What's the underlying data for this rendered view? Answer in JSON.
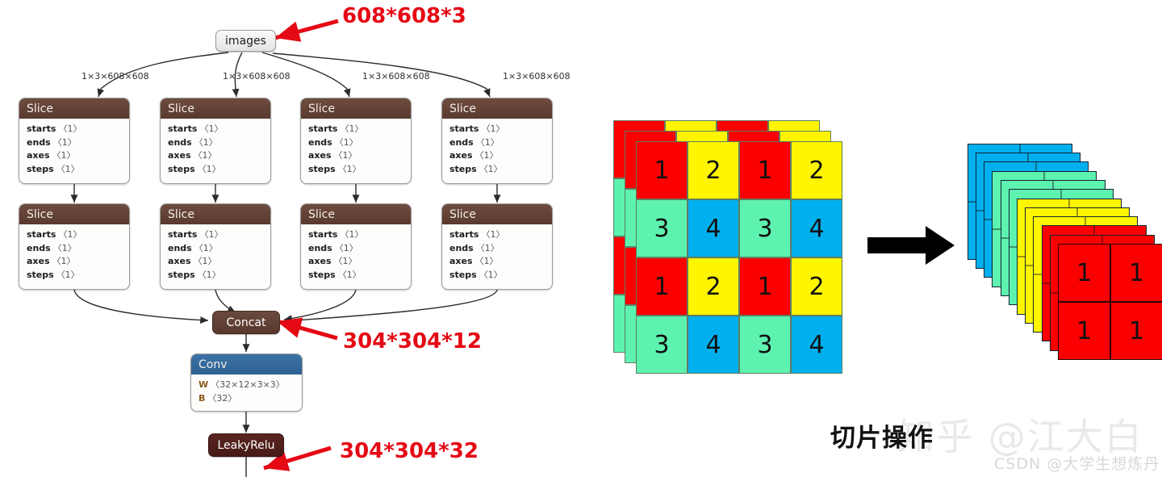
{
  "graph": {
    "input_node": {
      "label": "images"
    },
    "edge_labels": [
      "1×3×608×608",
      "1×3×608×608",
      "1×3×608×608",
      "1×3×608×608"
    ],
    "slice_title": "Slice",
    "slice_attrs": [
      {
        "name": "starts",
        "value": "〈1〉"
      },
      {
        "name": "ends",
        "value": "〈1〉"
      },
      {
        "name": "axes",
        "value": "〈1〉"
      },
      {
        "name": "steps",
        "value": "〈1〉"
      }
    ],
    "concat_node": {
      "label": "Concat"
    },
    "conv_node": {
      "label": "Conv",
      "attrs": [
        {
          "name": "W",
          "value": "〈32×12×3×3〉"
        },
        {
          "name": "B",
          "value": "〈32〉"
        }
      ]
    },
    "activation_node": {
      "label": "LeakyRelu"
    },
    "annotations": [
      {
        "text": "608*608*3",
        "color": "#e50914"
      },
      {
        "text": "304*304*12",
        "color": "#e50914"
      },
      {
        "text": "304*304*32",
        "color": "#e50914"
      }
    ]
  },
  "tensor_illustration": {
    "input_grid": {
      "rows": 4,
      "cols": 4,
      "values": [
        [
          "1",
          "2",
          "1",
          "2"
        ],
        [
          "3",
          "4",
          "3",
          "4"
        ],
        [
          "1",
          "2",
          "1",
          "2"
        ],
        [
          "3",
          "4",
          "3",
          "4"
        ]
      ],
      "colors": [
        [
          "#fa0000",
          "#fff500",
          "#fa0000",
          "#fff500"
        ],
        [
          "#5df2b0",
          "#00b0ee",
          "#5df2b0",
          "#00b0ee"
        ],
        [
          "#fa0000",
          "#fff500",
          "#fa0000",
          "#fff500"
        ],
        [
          "#5df2b0",
          "#00b0ee",
          "#5df2b0",
          "#00b0ee"
        ]
      ],
      "back_layers": 2
    },
    "output_stack": {
      "layer_count": 12,
      "layer_colors": [
        "#00b0ee",
        "#00b0ee",
        "#00b0ee",
        "#5df2b0",
        "#5df2b0",
        "#5df2b0",
        "#fff500",
        "#fff500",
        "#fff500",
        "#fa0000",
        "#fa0000",
        "#fa0000"
      ],
      "front_grid": {
        "rows": 2,
        "cols": 2,
        "values": [
          [
            "1",
            "1"
          ],
          [
            "1",
            "1"
          ]
        ],
        "color": "#fa0000"
      }
    },
    "arrow": {
      "name": "transform-arrow",
      "direction": "right",
      "color": "#000000"
    }
  },
  "captions": {
    "operation_title": "切片操作",
    "watermark_zhihu": "知乎 @江大白",
    "watermark_csdn": "CSDN @大学生想炼丹"
  }
}
